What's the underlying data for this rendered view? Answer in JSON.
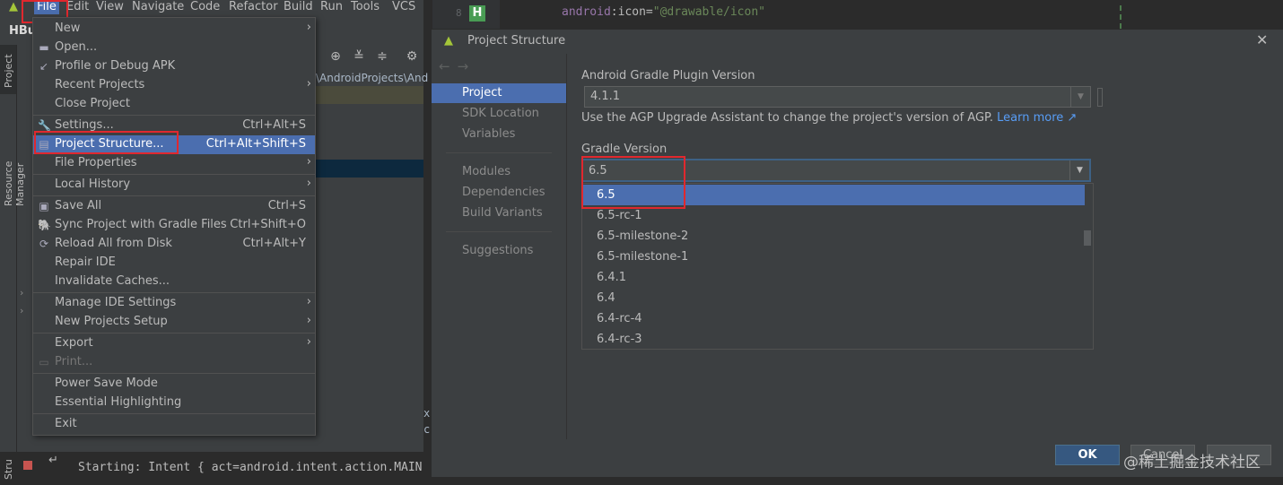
{
  "menubar": {
    "items": [
      "File",
      "Edit",
      "View",
      "Navigate",
      "Code",
      "Refactor",
      "Build",
      "Run",
      "Tools",
      "VCS"
    ]
  },
  "ide": {
    "project_title": "HBu",
    "left_tabs": [
      "Project",
      "Resource Manager"
    ],
    "bottom_tab": "Stru",
    "path_text": "\\AndroidProjects\\And",
    "run_console": "Starting: Intent { act=android.intent.action.MAIN",
    "side_text": "x\nc"
  },
  "file_menu": {
    "items": [
      {
        "label": "New",
        "shortcut": "",
        "submenu": true
      },
      {
        "label": "Open...",
        "shortcut": "",
        "submenu": false
      },
      {
        "label": "Profile or Debug APK",
        "shortcut": "",
        "submenu": false
      },
      {
        "label": "Recent Projects",
        "shortcut": "",
        "submenu": true
      },
      {
        "label": "Close Project",
        "shortcut": "",
        "submenu": false
      },
      {
        "label": "Settings...",
        "shortcut": "Ctrl+Alt+S",
        "submenu": false
      },
      {
        "label": "Project Structure...",
        "shortcut": "Ctrl+Alt+Shift+S",
        "submenu": false
      },
      {
        "label": "File Properties",
        "shortcut": "",
        "submenu": true
      },
      {
        "label": "Local History",
        "shortcut": "",
        "submenu": true
      },
      {
        "label": "Save All",
        "shortcut": "Ctrl+S",
        "submenu": false
      },
      {
        "label": "Sync Project with Gradle Files",
        "shortcut": "Ctrl+Shift+O",
        "submenu": false
      },
      {
        "label": "Reload All from Disk",
        "shortcut": "Ctrl+Alt+Y",
        "submenu": false
      },
      {
        "label": "Repair IDE",
        "shortcut": "",
        "submenu": false
      },
      {
        "label": "Invalidate Caches...",
        "shortcut": "",
        "submenu": false
      },
      {
        "label": "Manage IDE Settings",
        "shortcut": "",
        "submenu": true
      },
      {
        "label": "New Projects Setup",
        "shortcut": "",
        "submenu": true
      },
      {
        "label": "Export",
        "shortcut": "",
        "submenu": true
      },
      {
        "label": "Print...",
        "shortcut": "",
        "submenu": false
      },
      {
        "label": "Power Save Mode",
        "shortcut": "",
        "submenu": false
      },
      {
        "label": "Essential Highlighting",
        "shortcut": "",
        "submenu": false
      },
      {
        "label": "Exit",
        "shortcut": "",
        "submenu": false
      }
    ]
  },
  "editor": {
    "line_number": "8",
    "code_attr_ns": "android",
    "code_attr_name": ":icon=",
    "code_value": "\"@drawable/icon\""
  },
  "dialog": {
    "title": "Project Structure",
    "nav": [
      "Project",
      "SDK Location",
      "Variables",
      "Modules",
      "Dependencies",
      "Build Variants",
      "Suggestions"
    ],
    "agp_label": "Android Gradle Plugin Version",
    "agp_value": "4.1.1",
    "agp_note": "Use the AGP Upgrade Assistant to change the project's version of AGP.",
    "learn_more": "Learn more ↗",
    "gradle_label": "Gradle Version",
    "gradle_value": "6.5",
    "gradle_options": [
      "6.5",
      "6.5-rc-1",
      "6.5-milestone-2",
      "6.5-milestone-1",
      "6.4.1",
      "6.4",
      "6.4-rc-4",
      "6.4-rc-3"
    ],
    "ok_label": "OK",
    "cancel_label": "Cancel",
    "watermark": "@稀土掘金技术社区"
  },
  "colors": {
    "selection": "#4b6eaf",
    "highlight_box": "#e0282e",
    "background": "#3c3f41"
  }
}
